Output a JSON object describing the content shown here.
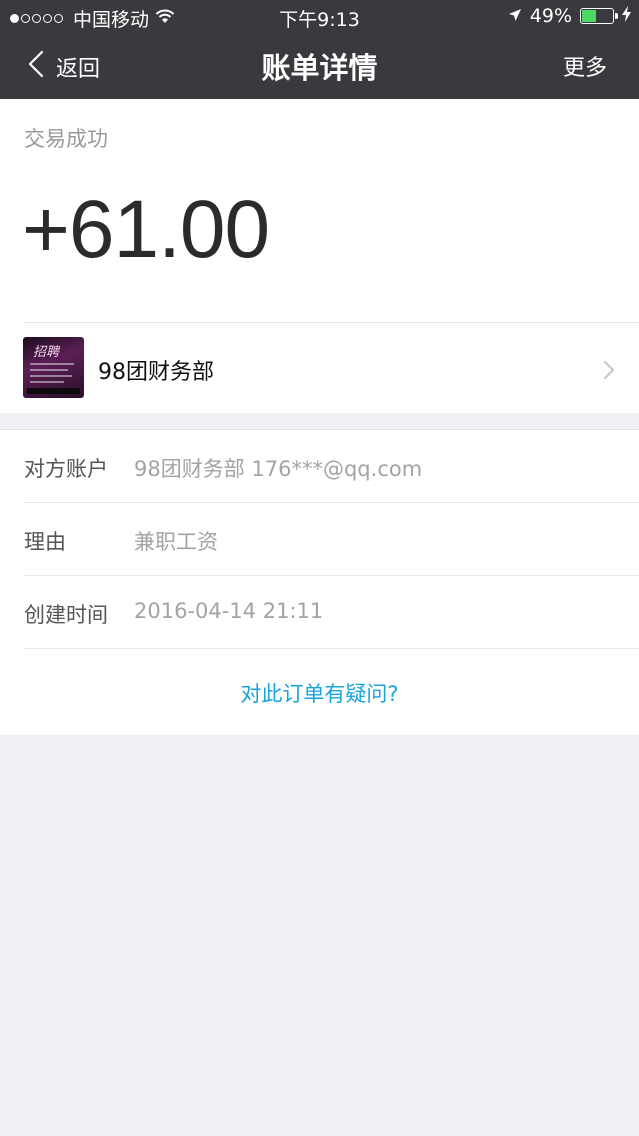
{
  "status_bar": {
    "carrier": "中国移动",
    "time": "下午9:13",
    "battery_percent": "49%",
    "battery_level": 0.49,
    "signal_bars_filled": 1,
    "signal_bars_total": 5,
    "icons": [
      "wifi-icon",
      "location-arrow-icon",
      "battery-icon",
      "charging-bolt-icon"
    ]
  },
  "nav": {
    "back_label": "返回",
    "title": "账单详情",
    "more_label": "更多"
  },
  "transaction": {
    "status": "交易成功",
    "amount": "+61.00"
  },
  "payer": {
    "name": "98团财务部",
    "avatar_text": "招聘"
  },
  "details": [
    {
      "label": "对方账户",
      "value": "98团财务部 176***@qq.com"
    },
    {
      "label": "理由",
      "value": "兼职工资"
    },
    {
      "label": "创建时间",
      "value": "2016-04-14 21:11"
    }
  ],
  "question_link": "对此订单有疑问?",
  "colors": {
    "header_bg": "#3a3a3e",
    "page_bg": "#efeff4",
    "link": "#1aa4dc",
    "battery_fill": "#4cd964"
  }
}
